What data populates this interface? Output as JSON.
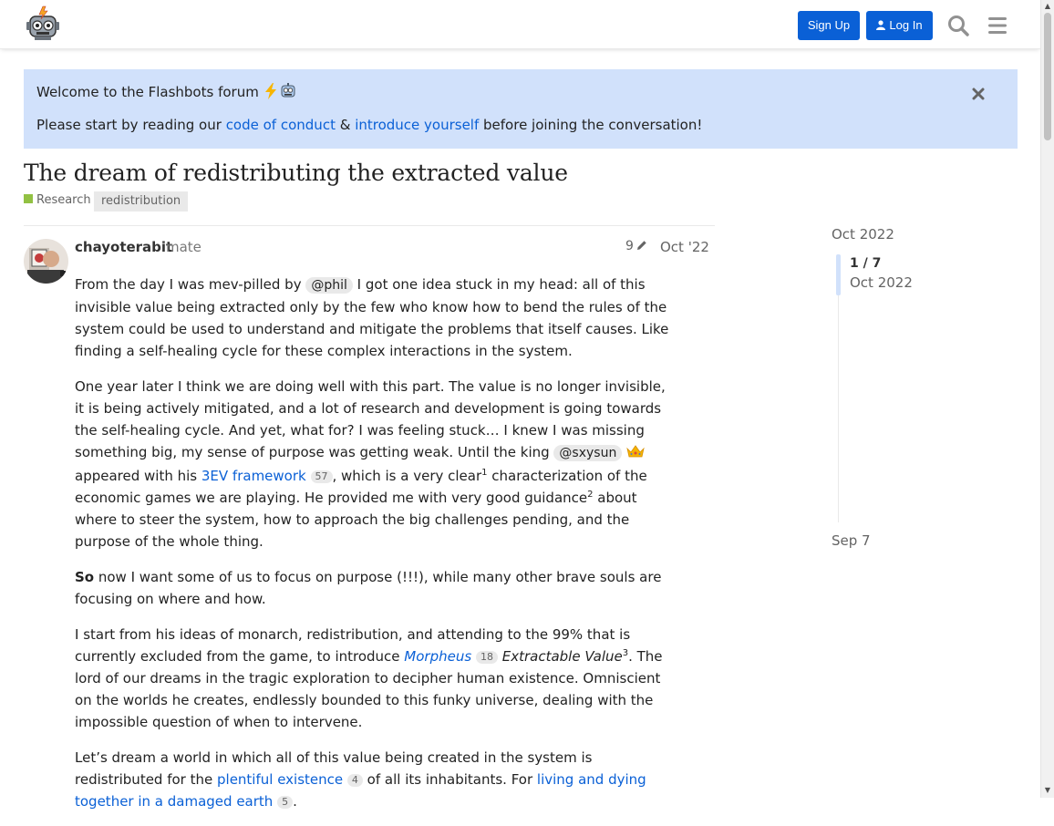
{
  "header": {
    "signup_label": "Sign Up",
    "login_label": "Log In"
  },
  "banner": {
    "title": "Welcome to the Flashbots forum",
    "text_before": "Please start by reading our ",
    "link_conduct": "code of conduct",
    "amp": " & ",
    "link_introduce": "introduce yourself",
    "text_after": " before joining the conversation!"
  },
  "topic": {
    "title": "The dream of redistributing the extracted value",
    "category": "Research",
    "tag": "redistribution"
  },
  "post": {
    "username": "chayoterabit",
    "user_title": "mate",
    "edits": "9",
    "date": "Oct '22",
    "p1": {
      "a": "From the day I was mev-pilled by ",
      "mention": "@phil",
      "b": " I got one idea stuck in my head: all of this invisible value being extracted only by the few who know how to bend the rules of the system could be used to understand and mitigate the problems that itself causes. Like finding a self-healing cycle for these complex interactions in the system."
    },
    "p2": {
      "a": "One year later I think we are doing well with this part. The value is no longer invisible, it is being actively mitigated, and a lot of research and development is going towards the self-healing cycle. And yet, what for? I was feeling stuck… I knew I was missing something big, my sense of purpose was getting weak. Until the king ",
      "mention": "@sxysun",
      "b": " appeared with his ",
      "link": "3EV framework",
      "link_count": "57",
      "c": ", which is a very clear",
      "sup1": "1",
      "d": " characterization of the economic games we are playing. He provided me with very good guidance",
      "sup2": "2",
      "e": " about where to steer the system, how to approach the big challenges pending, and the purpose of the whole thing."
    },
    "p3": {
      "bold": "So",
      "a": " now I want some of us to focus on purpose (!!!), while many other brave souls are focusing on where and how."
    },
    "p4": {
      "a": "I start from his ideas of monarch, redistribution, and attending to the 99% that is currently excluded from the game, to introduce ",
      "link": "Morpheus",
      "link_count": "18",
      "em": " Extractable Value",
      "sup3": "3",
      "b": ". The lord of our dreams in the tragic exploration to decipher human existence. Omniscient on the worlds he creates, endlessly bounded to this funky universe, dealing with the impossible question of when to intervene."
    },
    "p5": {
      "a": "Let’s dream a world in which all of this value being created in the system is redistributed for the ",
      "link1": "plentiful existence",
      "link1_count": "4",
      "b": " of all its inhabitants. For ",
      "link2": "living and dying together in a damaged earth",
      "link2_count": "5",
      "c": "."
    }
  },
  "timeline": {
    "top_date": "Oct 2022",
    "position": "1 / 7",
    "position_date": "Oct 2022",
    "bottom_date": "Sep 7"
  },
  "colors": {
    "accent": "#0a60d6",
    "banner_bg": "#d1e1fb",
    "category": "#92c143"
  },
  "icons": [
    "robot-logo-icon",
    "user-icon",
    "search-icon",
    "hamburger-menu-icon",
    "close-icon",
    "pencil-icon",
    "lightning-emoji",
    "robot-emoji",
    "crown-emoji"
  ]
}
